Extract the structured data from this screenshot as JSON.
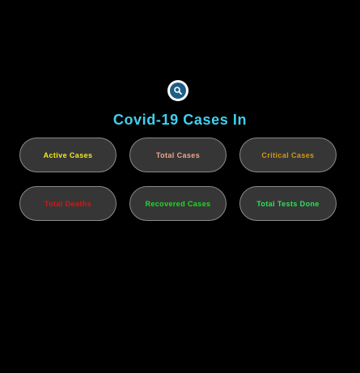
{
  "header": {
    "search_icon": "search-icon",
    "title": "Covid-19 Cases In"
  },
  "colors": {
    "background": "#000000",
    "title": "#3fd0f0",
    "card_bg": "#363636",
    "card_border": "#8a8a8a",
    "search_ring": "#ffffff",
    "search_fill": "#1f5e86"
  },
  "cards": [
    {
      "label": "Active Cases",
      "color": "#f2ea1e"
    },
    {
      "label": "Total Cases",
      "color": "#f0a58c"
    },
    {
      "label": "Critical Cases",
      "color": "#d09a10"
    },
    {
      "label": "Total Deaths",
      "color": "#d01a14"
    },
    {
      "label": "Recovered Cases",
      "color": "#27d62b"
    },
    {
      "label": "Total Tests Done",
      "color": "#2fe05a"
    }
  ]
}
